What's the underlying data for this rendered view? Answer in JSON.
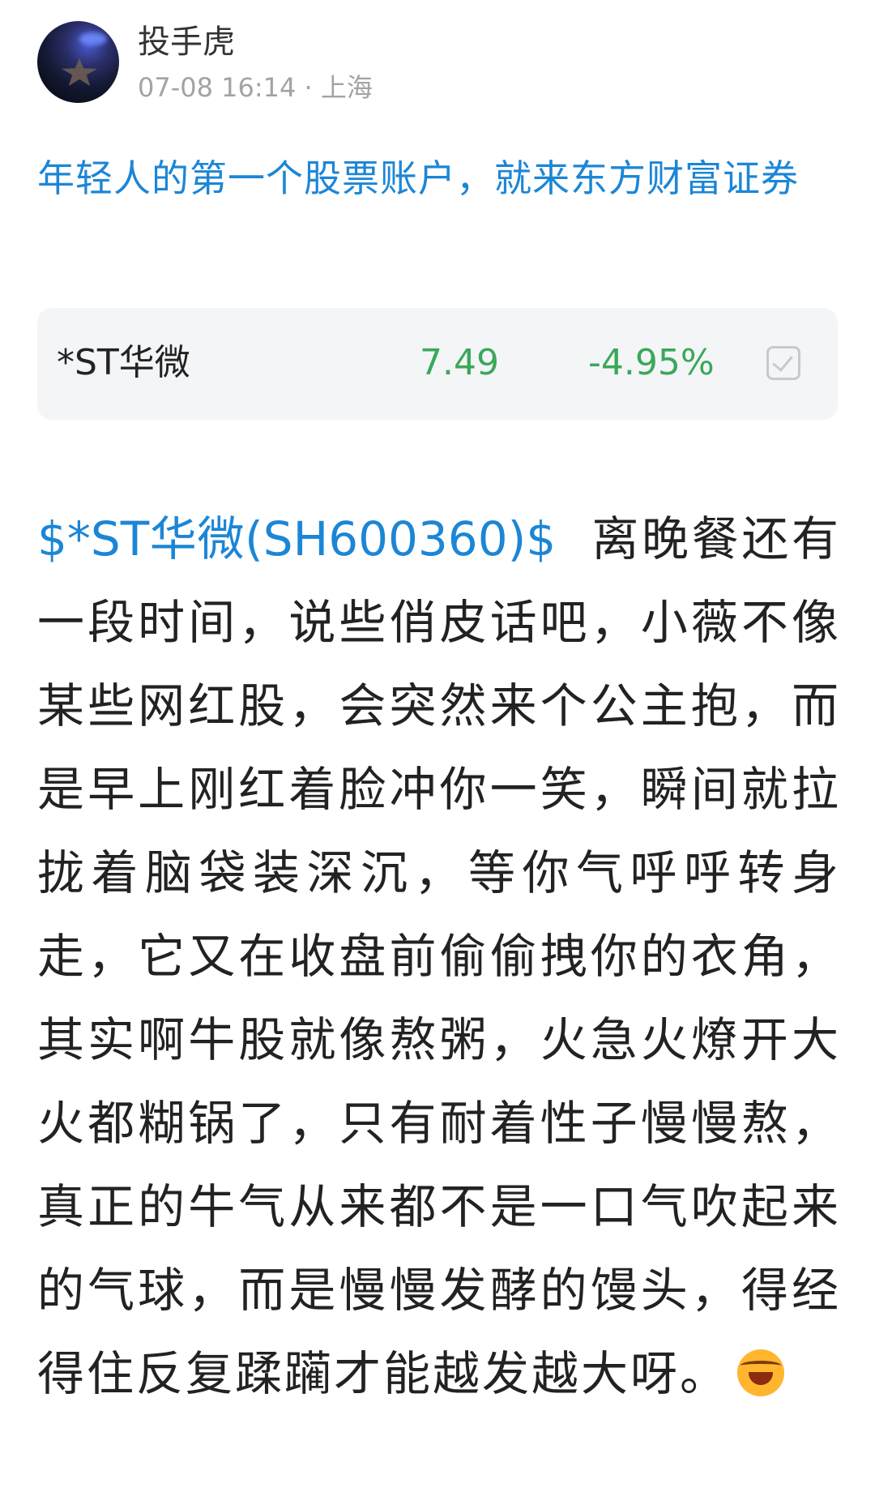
{
  "author": {
    "name": "投手虎",
    "meta": "07-08 16:14 · 上海"
  },
  "promo_text": "年轻人的第一个股票账户，就来东方财富证券",
  "stock_card": {
    "name": "*ST华微",
    "price": "7.49",
    "change": "-4.95%",
    "check_icon": "checkbox-icon",
    "price_color": "#3aa85a"
  },
  "post": {
    "stock_link": "$*ST华微(SH600360)$",
    "body": "离晚餐还有一段时间，说些俏皮话吧，小薇不像某些网红股，会突然来个公主抱，而是早上刚红着脸冲你一笑，瞬间就拉拢着脑袋装深沉，等你气呼呼转身走，它又在收盘前偷偷拽你的衣角，其实啊牛股就像熬粥，火急火燎开大火都糊锅了，只有耐着性子慢慢熬， 真正的牛气从来都不是一口气吹起来的气球，而是慢慢发酵的馒头，得经得住反复蹂躏才能越发越大呀。",
    "emoji": "laughing-crying-emoji"
  },
  "colors": {
    "link": "#1c86d6",
    "meta": "#a3a3a3",
    "card_bg": "#f4f5f7"
  }
}
